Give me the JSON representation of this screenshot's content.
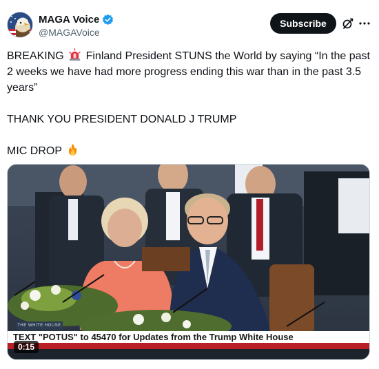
{
  "account": {
    "display_name": "MAGA Voice",
    "handle": "@MAGAVoice",
    "verified": true,
    "avatar_icon": "bald-eagle-flag-avatar"
  },
  "actions": {
    "subscribe_label": "Subscribe",
    "grok_icon": "grok-icon",
    "more_icon": "more-dots-icon"
  },
  "tweet": {
    "line1_prefix": "BREAKING",
    "line1_emoji": "rotating-light-emoji",
    "line1_text": "Finland President STUNS the World by saying “In the past 2 weeks we have had more progress ending this war than in the past 3.5 years”",
    "line2": "THANK YOU PRESIDENT DONALD J TRUMP",
    "line3_text": "MIC DROP",
    "line3_emoji": "fire-emoji"
  },
  "media": {
    "chyron": "TEXT \"POTUS\" to 45470 for Updates from the Trump White House",
    "network_tag": "THE WHITE HOUSE",
    "timestamp": "0:15"
  },
  "colors": {
    "verified_blue": "#1d9bf0",
    "chyron_red": "#b81f26",
    "subscribe_bg": "#0f1419"
  }
}
